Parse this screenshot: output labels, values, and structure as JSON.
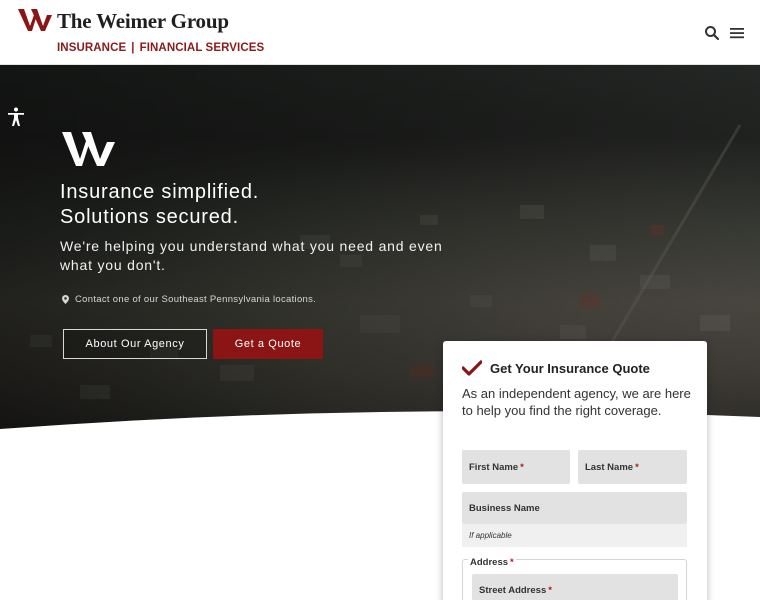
{
  "header": {
    "brand": "The Weimer Group",
    "tagline_left": "INSURANCE",
    "tagline_sep": "|",
    "tagline_right": "FINANCIAL SERVICES"
  },
  "hero": {
    "headline_line1": "Insurance simplified.",
    "headline_line2": "Solutions secured.",
    "subheadline": "We're helping you understand what you need and even what you don't.",
    "location_text": "Contact one of our Southeast Pennsylvania locations.",
    "about_button": "About Our Agency",
    "quote_button": "Get a Quote"
  },
  "quote_form": {
    "title": "Get Your Insurance Quote",
    "description": "As an independent agency, we are here to help you find the right coverage.",
    "first_name_label": "First Name",
    "last_name_label": "Last Name",
    "business_name_label": "Business Name",
    "business_help": "If applicable",
    "address_label": "Address",
    "street_label": "Street Address",
    "required_mark": "*"
  },
  "colors": {
    "brand_red": "#8b1414",
    "hero_dark": "#2a2e2b",
    "field_bg": "#e2e2e2"
  }
}
